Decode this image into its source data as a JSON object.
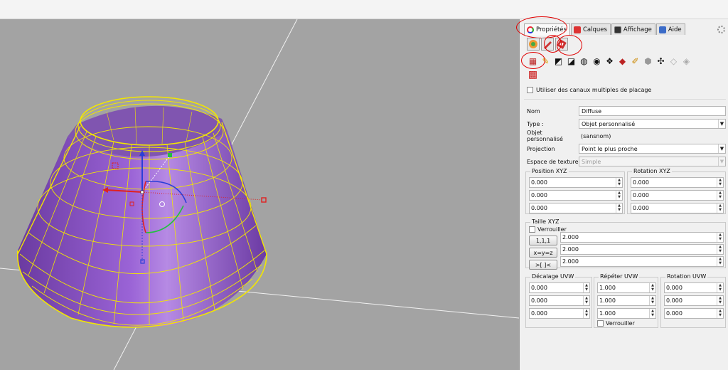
{
  "tabs": [
    {
      "label": "Propriétés",
      "icon": "properties-icon",
      "active": true
    },
    {
      "label": "Calques",
      "icon": "layers-icon",
      "active": false
    },
    {
      "label": "Affichage",
      "icon": "display-icon",
      "active": false
    },
    {
      "label": "Aide",
      "icon": "help-icon",
      "active": false
    }
  ],
  "multi_channel_label": "Utiliser des canaux multiples de placage",
  "fields": {
    "nom_label": "Nom",
    "nom_value": "Diffuse",
    "type_label": "Type :",
    "type_value": "Objet personnalisé",
    "objet_label": "Objet personnalisé",
    "objet_value": "(sansnom)",
    "projection_label": "Projection",
    "projection_value": "Point le plus proche",
    "espace_label": "Espace de texture",
    "espace_value": "Simple"
  },
  "position": {
    "title": "Position XYZ",
    "values": [
      "0.000",
      "0.000",
      "0.000"
    ]
  },
  "rotation": {
    "title": "Rotation XYZ",
    "values": [
      "0.000",
      "0.000",
      "0.000"
    ]
  },
  "taille": {
    "title": "Taille XYZ",
    "lock_label": "Verrouiller",
    "buttons": [
      "1,1,1",
      "x=y=z",
      ">[ ]<"
    ],
    "values": [
      "2.000",
      "2.000",
      "2.000"
    ]
  },
  "decalage": {
    "title": "Décalage UVW",
    "values": [
      "0.000",
      "0.000",
      "0.000"
    ]
  },
  "repeter": {
    "title": "Répéter UVW",
    "values": [
      "1.000",
      "1.000",
      "1.000"
    ],
    "lock_label": "Verrouiller"
  },
  "rotation_uvw": {
    "title": "Rotation UVW",
    "values": [
      "0.000",
      "0.000",
      "0.000"
    ]
  },
  "colors": {
    "viewport_bg": "#a3a3a3",
    "wire": "#f2e600",
    "surface": "#8a4fc4",
    "annotation": "#e00000"
  }
}
